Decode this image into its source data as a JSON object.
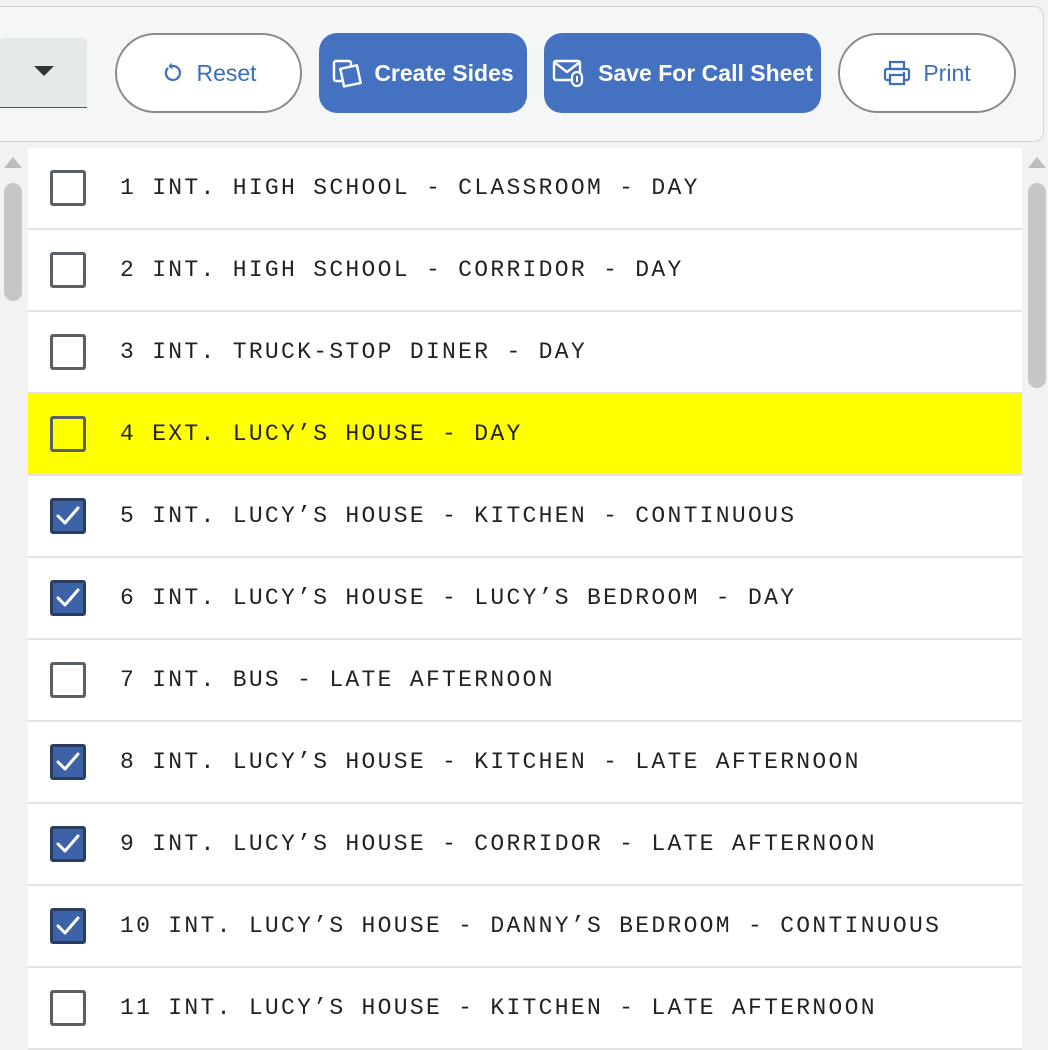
{
  "toolbar": {
    "reset_label": "Reset",
    "create_sides_label": "Create Sides",
    "save_call_sheet_label": "Save For Call Sheet",
    "print_label": "Print"
  },
  "colors": {
    "accent": "#4472c0",
    "highlight": "#ffff00",
    "checkbox_checked": "#3c62a8"
  },
  "scenes": [
    {
      "label": "1 INT. HIGH SCHOOL - CLASSROOM - DAY",
      "checked": false,
      "highlighted": false
    },
    {
      "label": "2 INT. HIGH SCHOOL - CORRIDOR - DAY",
      "checked": false,
      "highlighted": false
    },
    {
      "label": "3 INT. TRUCK-STOP DINER - DAY",
      "checked": false,
      "highlighted": false
    },
    {
      "label": "4 EXT. LUCY’S HOUSE - DAY",
      "checked": false,
      "highlighted": true
    },
    {
      "label": "5 INT. LUCY’S HOUSE - KITCHEN - CONTINUOUS",
      "checked": true,
      "highlighted": false
    },
    {
      "label": "6 INT. LUCY’S HOUSE - LUCY’S BEDROOM - DAY",
      "checked": true,
      "highlighted": false
    },
    {
      "label": "7 INT. BUS - LATE AFTERNOON",
      "checked": false,
      "highlighted": false
    },
    {
      "label": "8 INT. LUCY’S HOUSE - KITCHEN - LATE AFTERNOON",
      "checked": true,
      "highlighted": false
    },
    {
      "label": "9 INT. LUCY’S HOUSE - CORRIDOR - LATE AFTERNOON",
      "checked": true,
      "highlighted": false
    },
    {
      "label": "10 INT. LUCY’S HOUSE - DANNY’S BEDROOM - CONTINUOUS",
      "checked": true,
      "highlighted": false
    },
    {
      "label": "11 INT. LUCY’S HOUSE - KITCHEN - LATE AFTERNOON",
      "checked": false,
      "highlighted": false
    }
  ]
}
